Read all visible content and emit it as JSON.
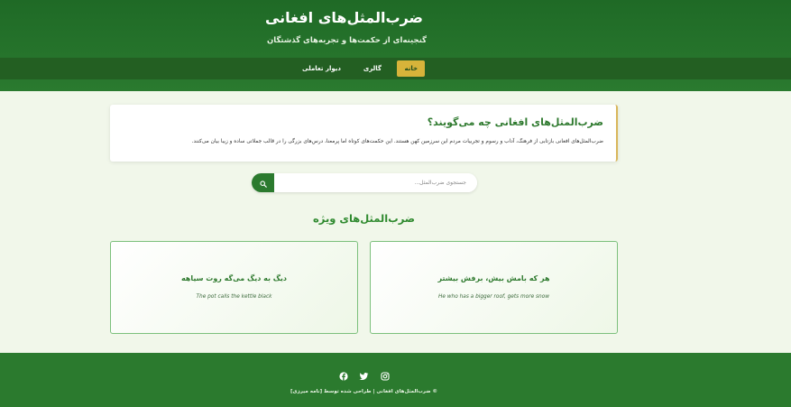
{
  "header": {
    "title": "ضرب‌المثل‌های افغانی",
    "subtitle": "گنجینه‌ای از حکمت‌ها و تجربه‌های گذشتگان"
  },
  "nav": {
    "home": "خانه",
    "gallery": "گالری",
    "wall": "دیوار تعاملی"
  },
  "intro": {
    "title": "ضرب‌المثل‌های افغانی چه می‌گویند؟",
    "text": "ضرب‌المثل‌های افغانی بازتابی از فرهنگ، آداب و رسوم و تجربیات مردم این سرزمین کهن هستند. این حکمت‌های کوتاه اما پرمعنا، درس‌های بزرگی را در قالب جملاتی ساده و زیبا بیان می‌کنند."
  },
  "search": {
    "placeholder": "جستجوی ضرب‌المثل..."
  },
  "featured": {
    "title": "ضرب‌المثل‌های ویژه",
    "cards": [
      {
        "text": "هر که بامش بیش، برفش بیشتر",
        "translation": "He who has a bigger roof, gets more snow"
      },
      {
        "text": "دیگ به دیگ می‌گه روت سیاهه",
        "translation": "The pot calls the kettle black"
      }
    ]
  },
  "footer": {
    "copyright": "© ضرب‌المثل‌های افغانی | طراحی شده توسط [نامه میرزی]"
  },
  "colors": {
    "primary": "#2b7a2e",
    "accent": "#d7b33a",
    "background": "#f1f7ea"
  }
}
